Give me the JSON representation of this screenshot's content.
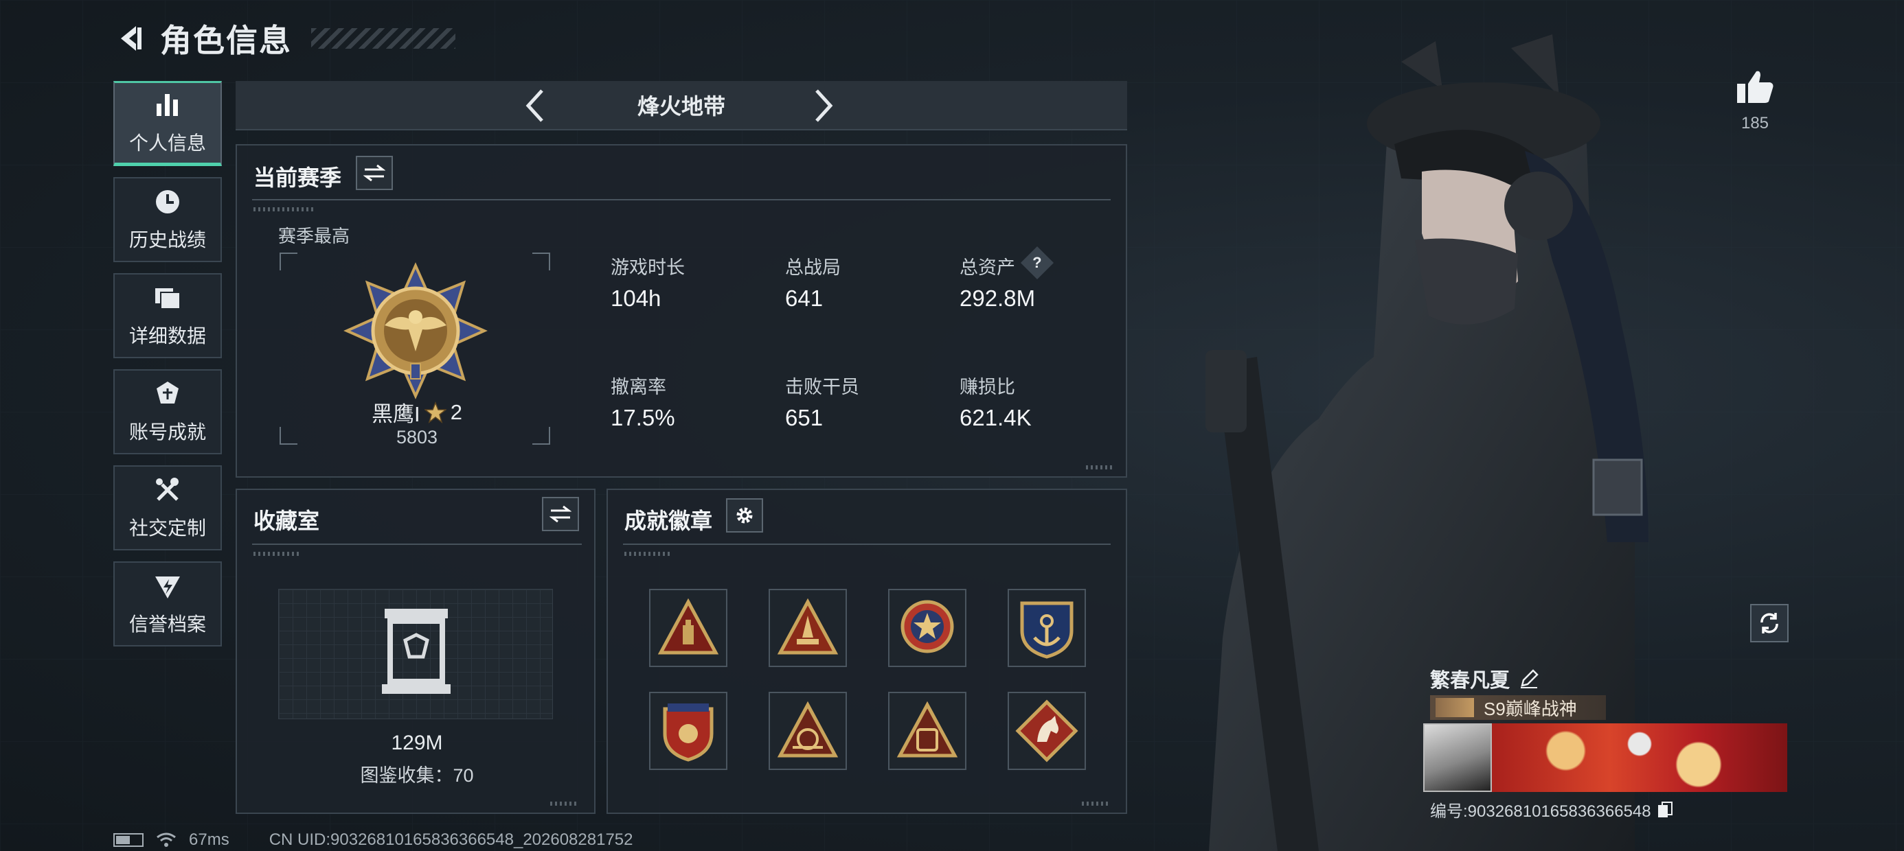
{
  "header": {
    "title": "角色信息"
  },
  "sidebar": {
    "items": [
      {
        "label": "个人信息",
        "icon": "bar-chart-icon",
        "active": true
      },
      {
        "label": "历史战绩",
        "icon": "clock-icon",
        "active": false
      },
      {
        "label": "详细数据",
        "icon": "folder-icon",
        "active": false
      },
      {
        "label": "账号成就",
        "icon": "achievement-icon",
        "active": false
      },
      {
        "label": "社交定制",
        "icon": "tools-icon",
        "active": false
      },
      {
        "label": "信誉档案",
        "icon": "shield-lightning-icon",
        "active": false
      }
    ]
  },
  "mode_tab": {
    "name": "烽火地带"
  },
  "season": {
    "title": "当前赛季",
    "subtitle": "赛季最高",
    "rank_name": "黑鹰I",
    "rank_stars": "2",
    "rank_points": "5803",
    "stats": [
      {
        "label": "游戏时长",
        "value": "104h"
      },
      {
        "label": "总战局",
        "value": "641"
      },
      {
        "label": "总资产",
        "value": "292.8M"
      },
      {
        "label": "撤离率",
        "value": "17.5%"
      },
      {
        "label": "击败干员",
        "value": "651"
      },
      {
        "label": "赚损比",
        "value": "621.4K"
      }
    ],
    "help_glyph": "?"
  },
  "collection": {
    "title": "收藏室",
    "value": "129M",
    "caption": "图鉴收集：70"
  },
  "achievements": {
    "title": "成就徽章",
    "badges": [
      {
        "icon": "triangle-badge-icon"
      },
      {
        "icon": "rocket-badge-icon"
      },
      {
        "icon": "star-medal-icon"
      },
      {
        "icon": "anchor-shield-icon"
      },
      {
        "icon": "star-shield-icon"
      },
      {
        "icon": "number-54-badge-icon"
      },
      {
        "icon": "number-55-badge-icon"
      },
      {
        "icon": "horse-diamond-icon"
      }
    ]
  },
  "profile": {
    "likes": "185",
    "name": "繁春凡夏",
    "title_tag": "S9巅峰战神",
    "id_line": "编号:9032681016583636654​8"
  },
  "status_bar": {
    "ping": "67ms",
    "uid": "CN UID:9032681016583636654​8_202608281752"
  },
  "colors": {
    "accent": "#4fd1ac",
    "gold": "#c9a45c",
    "panel": "#1c232a"
  }
}
